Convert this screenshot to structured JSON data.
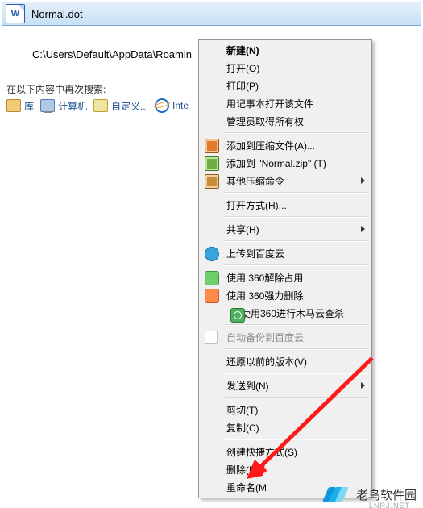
{
  "file": {
    "name": "Normal.dot",
    "icon_letter": "W"
  },
  "path": "C:\\Users\\Default\\AppData\\Roamin",
  "search_again_label": "在以下内容中再次搜索:",
  "toolbar": {
    "library": "库",
    "computer": "计算机",
    "custom": "自定义...",
    "internet": "Inte"
  },
  "menu": {
    "new": "新建(N)",
    "open": "打开(O)",
    "print": "打印(P)",
    "open_notepad": "用记事本打开该文件",
    "admin_owner": "管理员取得所有权",
    "add_archive": "添加到压缩文件(A)...",
    "add_normal_zip": "添加到 \"Normal.zip\" (T)",
    "other_compress": "其他压缩命令",
    "open_with": "打开方式(H)...",
    "share": "共享(H)",
    "upload_baidu": "上传到百度云",
    "clean_360": "使用 360解除占用",
    "force_del_360": "使用 360强力删除",
    "scan_360": "使用360进行木马云查杀",
    "auto_backup": "自动备份到百度云",
    "restore_prev": "还原以前的版本(V)",
    "send_to": "发送到(N)",
    "cut": "剪切(T)",
    "copy": "复制(C)",
    "create_shortcut": "创建快捷方式(S)",
    "delete": "删除(D)",
    "rename": "重命名(M"
  },
  "watermark": {
    "main": "老鸟软件园",
    "sub": "LNRJ.NET"
  }
}
